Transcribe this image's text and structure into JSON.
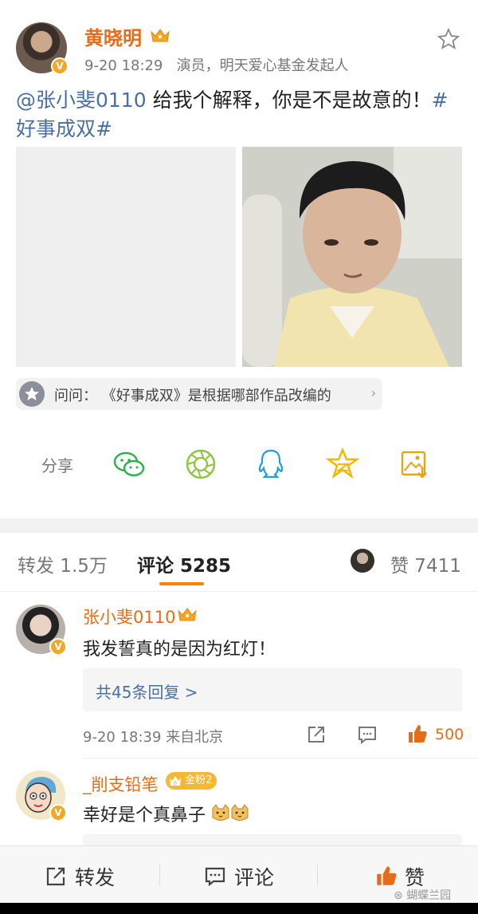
{
  "post": {
    "author": "黄晓明",
    "time": "9-20 18:29",
    "bio": "演员，明天爱心基金发起人",
    "mention": "@张小斐0110",
    "text": " 给我个解释，你是不是故意的！",
    "hashtag": "#好事成双#",
    "ask_prefix": "问问：",
    "ask_text": "《好事成双》是根据哪部作品改编的"
  },
  "share": {
    "label": "分享",
    "icons": [
      "wechat-icon",
      "moments-icon",
      "qq-icon",
      "qzone-icon",
      "save-image-icon"
    ]
  },
  "tabs": {
    "repost": "转发 1.5万",
    "comment": "评论 5285",
    "likes": "赞 7411"
  },
  "comments": [
    {
      "name": "张小斐0110",
      "text": "我发誓真的是因为红灯！",
      "replies": "共45条回复 >",
      "time": "9-20 18:39 来自北京",
      "likes": "500"
    },
    {
      "name": "_削支铅笔",
      "badge": "金粉2",
      "badge_level": "6",
      "text": "幸好是个真鼻子"
    }
  ],
  "bottom_bar": {
    "repost": "转发",
    "comment": "评论",
    "like": "赞"
  },
  "watermark": "蝴蝶兰园",
  "colors": {
    "brand_orange": "#ff8200",
    "name_orange": "#e86c17",
    "link_blue": "#4a6fa5",
    "wechat_green": "#2bb24c",
    "qq_blue": "#1f9de6",
    "qzone_yellow": "#f7b500"
  }
}
